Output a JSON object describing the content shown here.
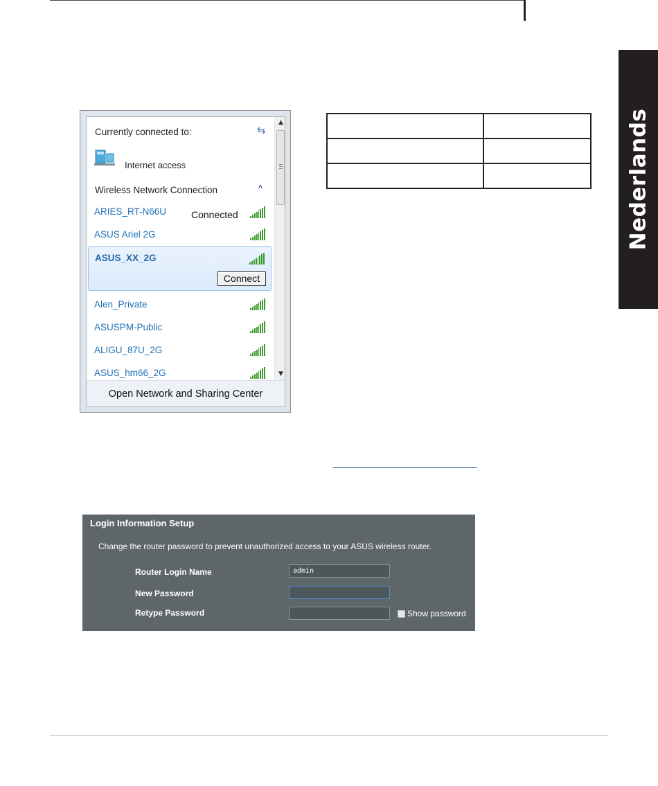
{
  "side_tab": {
    "language": "Nederlands"
  },
  "wifi_flyout": {
    "currently_connected_label": "Currently connected to:",
    "internet_access_label": "Internet access",
    "section_header": "Wireless Network Connection",
    "networks": [
      {
        "name": "ARIES_RT-N66U",
        "status": "Connected"
      },
      {
        "name": "ASUS Ariel 2G"
      },
      {
        "name": "ASUS_XX_2G",
        "button": "Connect"
      },
      {
        "name": "Alen_Private"
      },
      {
        "name": "ASUSPM-Public"
      },
      {
        "name": "ALIGU_87U_2G"
      },
      {
        "name": "ASUS_hm66_2G"
      }
    ],
    "footer_link": "Open Network and Sharing Center"
  },
  "login_setup": {
    "title": "Login Information Setup",
    "description": "Change the router password to prevent unauthorized access to your ASUS wireless router.",
    "router_login_name_label": "Router Login Name",
    "router_login_name_value": "admin",
    "new_password_label": "New Password",
    "retype_password_label": "Retype Password",
    "show_password_label": "Show password"
  },
  "colors": {
    "accent_blue": "#1f6fb5",
    "panel_bg": "#5e6669",
    "signal_green": "#3c9a2c",
    "side_tab_bg": "#231f20"
  }
}
